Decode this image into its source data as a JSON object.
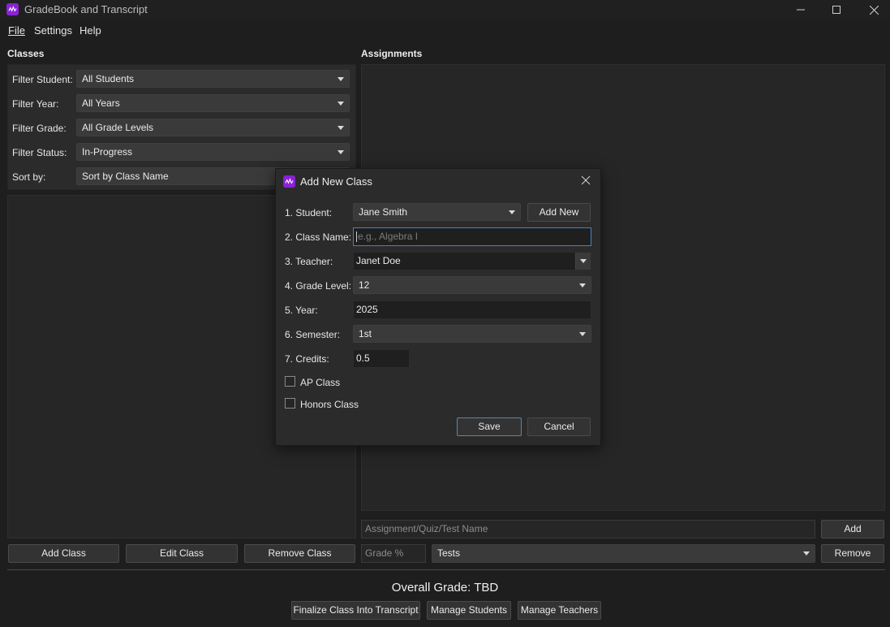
{
  "window": {
    "title": "GradeBook and Transcript"
  },
  "menu": {
    "file": "File",
    "settings": "Settings",
    "help": "Help"
  },
  "classes": {
    "title": "Classes",
    "filters": [
      {
        "label": "Filter Student:",
        "value": "All Students"
      },
      {
        "label": "Filter Year:",
        "value": "All Years"
      },
      {
        "label": "Filter Grade:",
        "value": "All Grade Levels"
      },
      {
        "label": "Filter Status:",
        "value": "In-Progress"
      },
      {
        "label": "Sort by:",
        "value": "Sort by Class Name"
      }
    ],
    "buttons": {
      "add": "Add Class",
      "edit": "Edit Class",
      "remove": "Remove Class"
    }
  },
  "assignments": {
    "title": "Assignments",
    "name_placeholder": "Assignment/Quiz/Test Name",
    "grade_placeholder": "Grade %",
    "category": "Tests",
    "add": "Add",
    "remove": "Remove"
  },
  "footer": {
    "overall": "Overall Grade: TBD",
    "finalize": "Finalize Class Into Transcript",
    "manage_students": "Manage Students",
    "manage_teachers": "Manage Teachers"
  },
  "dialog": {
    "title": "Add New Class",
    "student_label": "1. Student:",
    "student_value": "Jane Smith",
    "add_new": "Add New",
    "class_name_label": "2. Class Name:",
    "class_name_placeholder": "e.g., Algebra I",
    "teacher_label": "3. Teacher:",
    "teacher_value": "Janet Doe",
    "grade_level_label": "4. Grade Level:",
    "grade_level_value": "12",
    "year_label": "5. Year:",
    "year_value": "2025",
    "semester_label": "6. Semester:",
    "semester_value": "1st",
    "credits_label": "7. Credits:",
    "credits_value": "0.5",
    "ap_label": "AP Class",
    "ap_checked": false,
    "honors_label": "Honors Class",
    "honors_checked": false,
    "save": "Save",
    "cancel": "Cancel"
  },
  "colors": {
    "accent": "#8a22d6",
    "focus": "#4a7fc1"
  }
}
